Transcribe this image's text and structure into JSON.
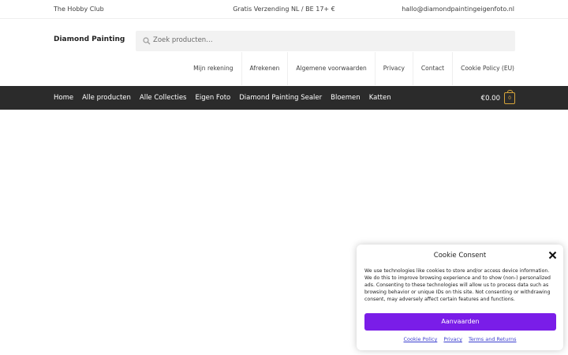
{
  "topbar": {
    "left": "The Hobby Club",
    "center": "Gratis Verzending NL / BE 17+ €",
    "right": "hallo@diamondpaintingeigenfoto.nl"
  },
  "header": {
    "brand": "Diamond Painting",
    "search_placeholder": "Zoek producten…"
  },
  "secondary_nav": {
    "items": [
      "Mijn rekening",
      "Afrekenen",
      "Algemene voorwaarden",
      "Privacy",
      "Contact",
      "Cookie Policy (EU)"
    ]
  },
  "main_nav": {
    "items": [
      "Home",
      "Alle producten",
      "Alle Collecties",
      "Eigen Foto",
      "Diamond Painting Sealer",
      "Bloemen",
      "Katten"
    ],
    "cart_total": "€0.00",
    "cart_count": "0"
  },
  "consent": {
    "title": "Cookie Consent",
    "body": "We use technologies like cookies to store and/or access device information. We do this to improve browsing experience and to show (non-) personalized ads. Consenting to these technologies will allow us to process data such as browsing behavior or unique IDs on this site. Not consenting or withdrawing consent, may adversely affect certain features and functions.",
    "accept_label": "Aanvaarden",
    "links": [
      "Cookie Policy",
      "Privacy",
      "Terms and Returns"
    ]
  },
  "colors": {
    "nav_background": "#2b2b2b",
    "accept_button": "#7a1de8",
    "cart_accent": "#d6a43a",
    "link": "#3b3fcf"
  },
  "icons": {
    "search": "search-icon",
    "close": "close-icon",
    "cart": "cart-icon"
  }
}
